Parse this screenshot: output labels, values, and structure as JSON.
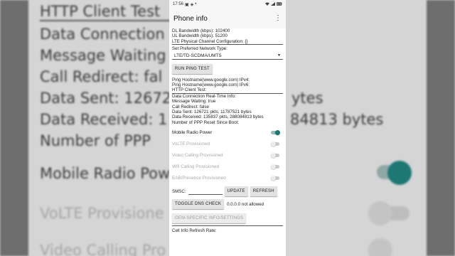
{
  "colors": {
    "accent": "#1d7874",
    "accent_track": "#8fbcb9",
    "disabled_text": "#a9a9a9",
    "background_blur": "#d5d5d5"
  },
  "background": {
    "lines": [
      "HTTP Client Test",
      "Data Connection",
      "Message Waiting",
      "Call Redirect: fal",
      "Data Sent: 12672",
      "Data Received: 1",
      "Number of PPP",
      "Mobile Radio Pow",
      "VoLTE Provisione",
      "Video Calling Pro"
    ],
    "fragments": [
      "ytes",
      "84813 bytes"
    ]
  },
  "status_bar": {
    "time": "17:56",
    "left_icons": [
      "gallery-icon",
      "camera-icon",
      "dot-icon"
    ],
    "right_icons": [
      "wifi-icon",
      "signal-icon",
      "battery-icon"
    ]
  },
  "app_bar": {
    "title": "Phone info",
    "menu_icon": "overflow-menu-icon"
  },
  "info": {
    "dl_bandwidth": "DL Bandwidth (kbps): 102400",
    "ul_bandwidth": "UL Bandwidth (kbps): 51200",
    "lte_config": "LTE Physical Channel Configuration: {}",
    "network_type_label": "Set Preferred Network Type:",
    "network_type_value": "LTE/TD-SCDMA/UMTS",
    "ping_button": "RUN PING TEST",
    "ping_ipv4": "Ping Hostname(www.google.com) IPv4:",
    "ping_ipv6": "Ping Hostname(www.google.com) IPv6:",
    "http_client_test": "HTTP Client Test:",
    "data_conn_realtime": "Data Connection Real-Time Info:",
    "message_waiting": "Message Waiting: true",
    "call_redirect": "Call Redirect: false",
    "data_sent": "Data Sent: 126721 pkts, 11787521 bytes",
    "data_received": "Data Received: 135837 pkts, 288084813 bytes",
    "ppp_reset": "Number of PPP Reset Since Boot:"
  },
  "toggles": [
    {
      "label": "Mobile Radio Power",
      "on": true,
      "enabled": true
    },
    {
      "label": "VoLTE Provisioned",
      "on": false,
      "enabled": false
    },
    {
      "label": "Video Calling Provisioned",
      "on": false,
      "enabled": false
    },
    {
      "label": "Wifi Calling Provisioned",
      "on": false,
      "enabled": false
    },
    {
      "label": "EAB/Presence Provisioned",
      "on": false,
      "enabled": false
    }
  ],
  "smsc": {
    "label": "SMSC:",
    "value": "",
    "update_button": "UPDATE",
    "refresh_button": "REFRESH"
  },
  "dns": {
    "button": "TOGGLE DNS CHECK",
    "status": "0.0.0.0 not allowed"
  },
  "oem_button": "OEM-SPECIFIC INFO/SETTINGS",
  "cell_info_refresh": "Cell Info Refresh Rate:"
}
